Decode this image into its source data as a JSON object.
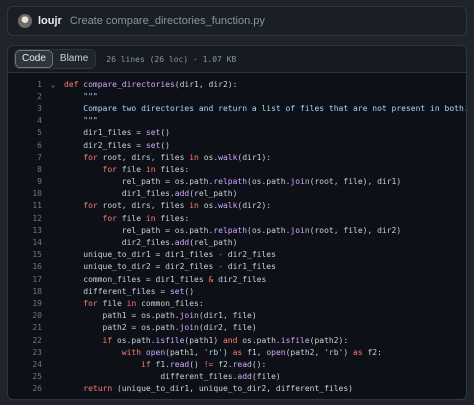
{
  "commit": {
    "author": "loujr",
    "message": "Create compare_directories_function.py"
  },
  "file": {
    "tabs": [
      {
        "label": "Code",
        "active": true
      },
      {
        "label": "Blame",
        "active": false
      }
    ],
    "info": "26 lines (26 loc) · 1.07 KB"
  },
  "icons": {
    "fold": "chevron-down-icon"
  },
  "code_lines": [
    {
      "n": "1",
      "fold": true,
      "tokens": [
        [
          "kw",
          "def "
        ],
        [
          "fn",
          "compare_directories"
        ],
        [
          "",
          "(dir1, dir2):"
        ]
      ]
    },
    {
      "n": "2",
      "tokens": [
        [
          "str",
          "    \"\"\""
        ]
      ]
    },
    {
      "n": "3",
      "tokens": [
        [
          "str",
          "    Compare two directories and return a list of files that are not present in both."
        ]
      ]
    },
    {
      "n": "4",
      "tokens": [
        [
          "str",
          "    \"\"\""
        ]
      ]
    },
    {
      "n": "5",
      "tokens": [
        [
          "",
          "    dir1_files = "
        ],
        [
          "fn",
          "set"
        ],
        [
          "",
          "()"
        ]
      ]
    },
    {
      "n": "6",
      "tokens": [
        [
          "",
          "    dir2_files = "
        ],
        [
          "fn",
          "set"
        ],
        [
          "",
          "()"
        ]
      ]
    },
    {
      "n": "7",
      "tokens": [
        [
          "kw",
          "    for "
        ],
        [
          "",
          "root, dirs, files "
        ],
        [
          "kw",
          "in "
        ],
        [
          "",
          "os."
        ],
        [
          "fn",
          "walk"
        ],
        [
          "",
          "(dir1):"
        ]
      ]
    },
    {
      "n": "8",
      "tokens": [
        [
          "kw",
          "        for "
        ],
        [
          "",
          "file "
        ],
        [
          "kw",
          "in "
        ],
        [
          "",
          "files:"
        ]
      ]
    },
    {
      "n": "9",
      "tokens": [
        [
          "",
          "            rel_path = os.path."
        ],
        [
          "fn",
          "relpath"
        ],
        [
          "",
          "(os.path."
        ],
        [
          "fn",
          "join"
        ],
        [
          "",
          "(root, file), dir1)"
        ]
      ]
    },
    {
      "n": "10",
      "tokens": [
        [
          "",
          "            dir1_files."
        ],
        [
          "fn",
          "add"
        ],
        [
          "",
          "(rel_path)"
        ]
      ]
    },
    {
      "n": "11",
      "tokens": [
        [
          "kw",
          "    for "
        ],
        [
          "",
          "root, dirs, files "
        ],
        [
          "kw",
          "in "
        ],
        [
          "",
          "os."
        ],
        [
          "fn",
          "walk"
        ],
        [
          "",
          "(dir2):"
        ]
      ]
    },
    {
      "n": "12",
      "tokens": [
        [
          "kw",
          "        for "
        ],
        [
          "",
          "file "
        ],
        [
          "kw",
          "in "
        ],
        [
          "",
          "files:"
        ]
      ]
    },
    {
      "n": "13",
      "tokens": [
        [
          "",
          "            rel_path = os.path."
        ],
        [
          "fn",
          "relpath"
        ],
        [
          "",
          "(os.path."
        ],
        [
          "fn",
          "join"
        ],
        [
          "",
          "(root, file), dir2)"
        ]
      ]
    },
    {
      "n": "14",
      "tokens": [
        [
          "",
          "            dir2_files."
        ],
        [
          "fn",
          "add"
        ],
        [
          "",
          "(rel_path)"
        ]
      ]
    },
    {
      "n": "15",
      "tokens": [
        [
          "",
          "    unique_to_dir1 = dir1_files "
        ],
        [
          "kw",
          "- "
        ],
        [
          "",
          "dir2_files"
        ]
      ]
    },
    {
      "n": "16",
      "tokens": [
        [
          "",
          "    unique_to_dir2 = dir2_files "
        ],
        [
          "kw",
          "- "
        ],
        [
          "",
          "dir1_files"
        ]
      ]
    },
    {
      "n": "17",
      "tokens": [
        [
          "",
          "    common_files = dir1_files "
        ],
        [
          "kw",
          "& "
        ],
        [
          "",
          "dir2_files"
        ]
      ]
    },
    {
      "n": "18",
      "tokens": [
        [
          "",
          "    different_files = "
        ],
        [
          "fn",
          "set"
        ],
        [
          "",
          "()"
        ]
      ]
    },
    {
      "n": "19",
      "tokens": [
        [
          "kw",
          "    for "
        ],
        [
          "",
          "file "
        ],
        [
          "kw",
          "in "
        ],
        [
          "",
          "common_files:"
        ]
      ]
    },
    {
      "n": "20",
      "tokens": [
        [
          "",
          "        path1 = os.path."
        ],
        [
          "fn",
          "join"
        ],
        [
          "",
          "(dir1, file)"
        ]
      ]
    },
    {
      "n": "21",
      "tokens": [
        [
          "",
          "        path2 = os.path."
        ],
        [
          "fn",
          "join"
        ],
        [
          "",
          "(dir2, file)"
        ]
      ]
    },
    {
      "n": "22",
      "tokens": [
        [
          "kw",
          "        if "
        ],
        [
          "",
          "os.path."
        ],
        [
          "fn",
          "isfile"
        ],
        [
          "",
          "(path1) "
        ],
        [
          "kw",
          "and "
        ],
        [
          "",
          "os.path."
        ],
        [
          "fn",
          "isfile"
        ],
        [
          "",
          "(path2):"
        ]
      ]
    },
    {
      "n": "23",
      "tokens": [
        [
          "kw",
          "            with "
        ],
        [
          "fn",
          "open"
        ],
        [
          "",
          "(path1, "
        ],
        [
          "str",
          "'rb'"
        ],
        [
          "",
          ") "
        ],
        [
          "kw",
          "as "
        ],
        [
          "",
          "f1, "
        ],
        [
          "fn",
          "open"
        ],
        [
          "",
          "(path2, "
        ],
        [
          "str",
          "'rb'"
        ],
        [
          "",
          ") "
        ],
        [
          "kw",
          "as "
        ],
        [
          "",
          "f2:"
        ]
      ]
    },
    {
      "n": "24",
      "tokens": [
        [
          "kw",
          "                if "
        ],
        [
          "",
          "f1."
        ],
        [
          "fn",
          "read"
        ],
        [
          "",
          "() "
        ],
        [
          "kw",
          "!= "
        ],
        [
          "",
          "f2."
        ],
        [
          "fn",
          "read"
        ],
        [
          "",
          "():"
        ]
      ]
    },
    {
      "n": "25",
      "tokens": [
        [
          "",
          "                    different_files."
        ],
        [
          "fn",
          "add"
        ],
        [
          "",
          "(file)"
        ]
      ]
    },
    {
      "n": "26",
      "tokens": [
        [
          "kw",
          "    return "
        ],
        [
          "",
          "(unique_to_dir1, unique_to_dir2, different_files)"
        ]
      ]
    }
  ]
}
